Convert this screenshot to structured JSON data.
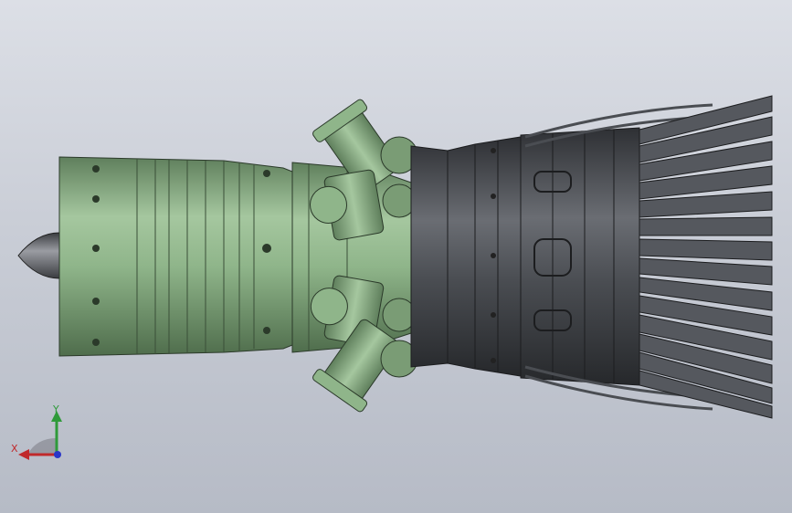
{
  "viewport": {
    "background_top": "#dcdfe6",
    "background_bottom": "#b6bbc6"
  },
  "model": {
    "icon": "jet-engine-cad-model",
    "colors": {
      "compressor": "#8fb58a",
      "compressor_dark": "#5f7f5c",
      "combustor": "#8fb58a",
      "turbine": "#4a4d52",
      "nozzle": "#55585e",
      "spinner": "#5c5f66"
    }
  },
  "triad": {
    "x_label": "X",
    "y_label": "Y",
    "colors": {
      "x": "#c0292b",
      "y": "#2f9a3a",
      "z": "#2a36c8"
    }
  }
}
